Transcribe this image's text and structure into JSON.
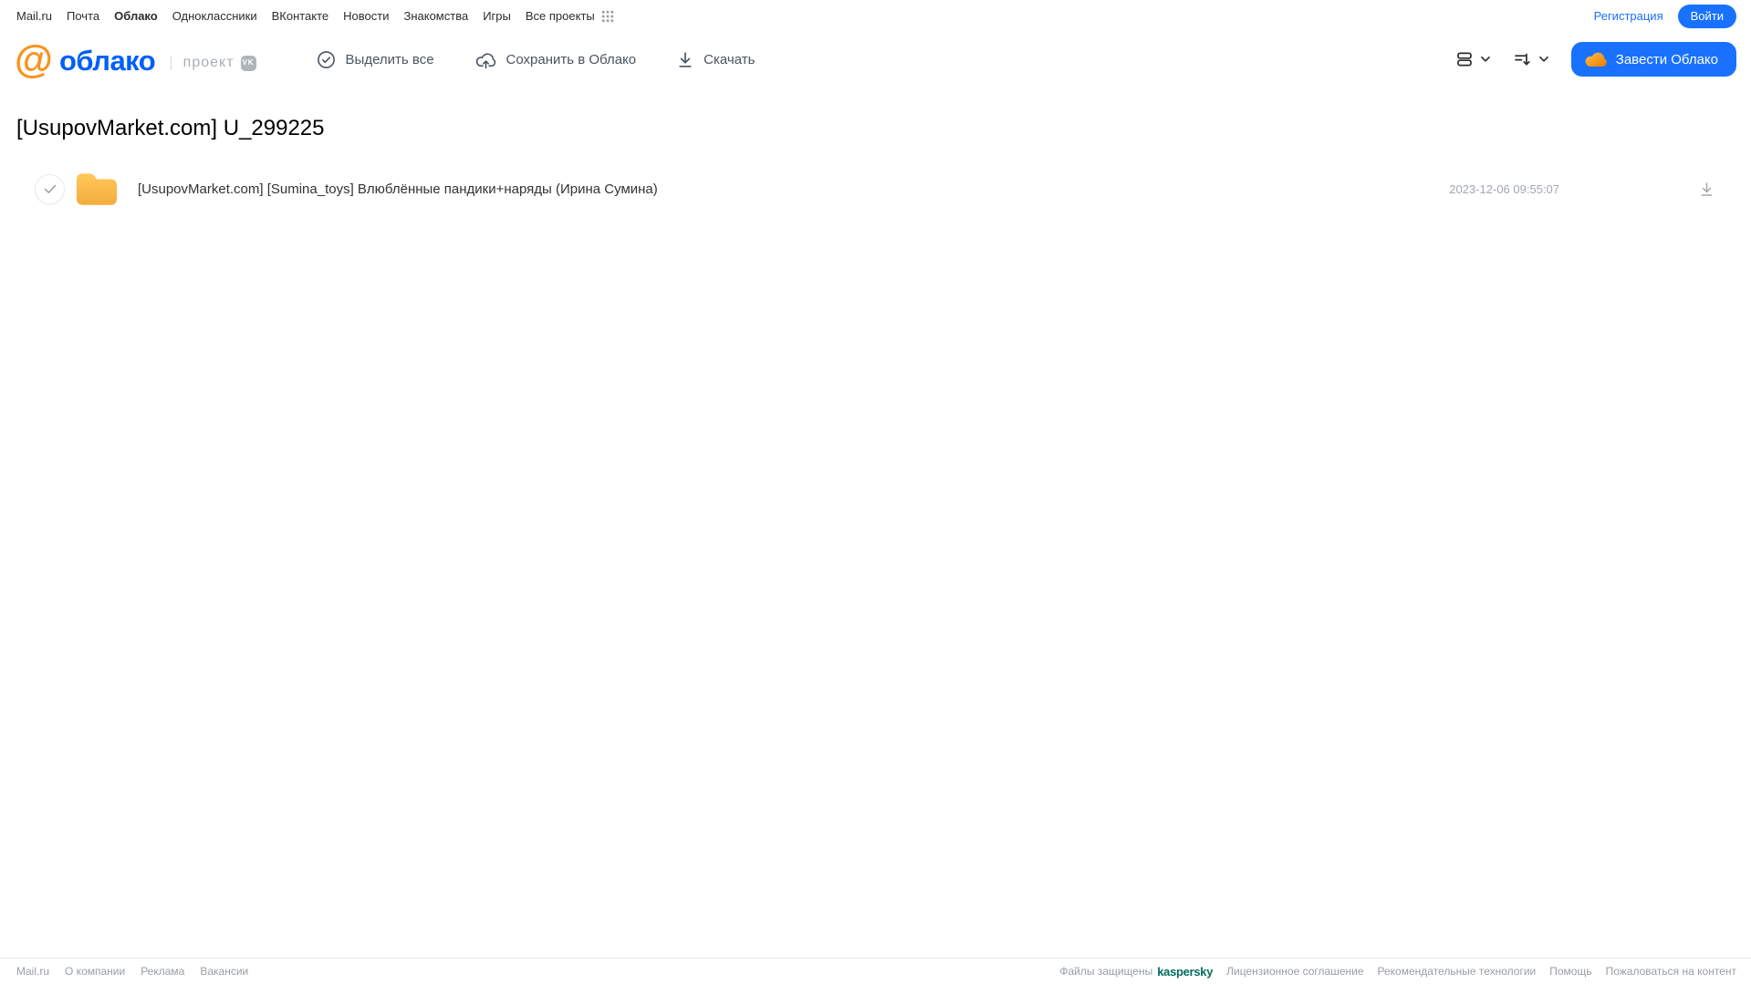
{
  "topnav": {
    "items": [
      {
        "label": "Mail.ru",
        "active": false
      },
      {
        "label": "Почта",
        "active": false
      },
      {
        "label": "Облако",
        "active": true
      },
      {
        "label": "Одноклассники",
        "active": false
      },
      {
        "label": "ВКонтакте",
        "active": false
      },
      {
        "label": "Новости",
        "active": false
      },
      {
        "label": "Знакомства",
        "active": false
      },
      {
        "label": "Игры",
        "active": false
      },
      {
        "label": "Все проекты",
        "active": false
      }
    ],
    "registration_label": "Регистрация",
    "login_label": "Войти"
  },
  "header": {
    "logo_at": "@",
    "logo_text": "облако",
    "project_label": "проект",
    "vk_badge_label": "VK",
    "toolbar": {
      "select_all_label": "Выделить все",
      "save_to_cloud_label": "Сохранить в Облако",
      "download_label": "Скачать"
    },
    "get_cloud_label": "Завести Облако"
  },
  "main": {
    "title": "[UsupovMarket.com] U_299225",
    "files": [
      {
        "type": "folder",
        "name": "[UsupovMarket.com] [Sumina_toys] Влюблённые пандики+наряды (Ирина Сумина)",
        "date": "2023-12-06 09:55:07"
      }
    ]
  },
  "footer": {
    "left_links": [
      {
        "label": "Mail.ru"
      },
      {
        "label": "О компании"
      },
      {
        "label": "Реклама"
      },
      {
        "label": "Вакансии"
      }
    ],
    "protected_label": "Файлы защищены",
    "kaspersky_label": "kaspersky",
    "right_links": [
      {
        "label": "Лицензионное соглашение"
      },
      {
        "label": "Рекомендательные технологии"
      },
      {
        "label": "Помощь"
      },
      {
        "label": "Пожаловаться на контент"
      }
    ]
  },
  "icons": {
    "grid_icon": "3x3-dots",
    "check_circle_icon": "check-in-circle",
    "cloud_upload_icon": "cloud-with-up-arrow",
    "download_icon": "arrow-down-with-bar",
    "view_mode_icon": "stacked-rows",
    "sort_icon": "lines-with-down-arrow",
    "chevron_down_icon": "chevron-down",
    "folder_icon": "yellow-folder",
    "cloud_logo_icon": "orange-cloud"
  },
  "colors": {
    "accent_blue": "#1971FF",
    "logo_blue": "#005FF9",
    "logo_orange": "#F89420",
    "folder_yellow": "#FBBE4F",
    "kaspersky_green": "#006D5C",
    "toolbar_gray": "#49545F",
    "muted_gray": "#A3A8AE"
  }
}
